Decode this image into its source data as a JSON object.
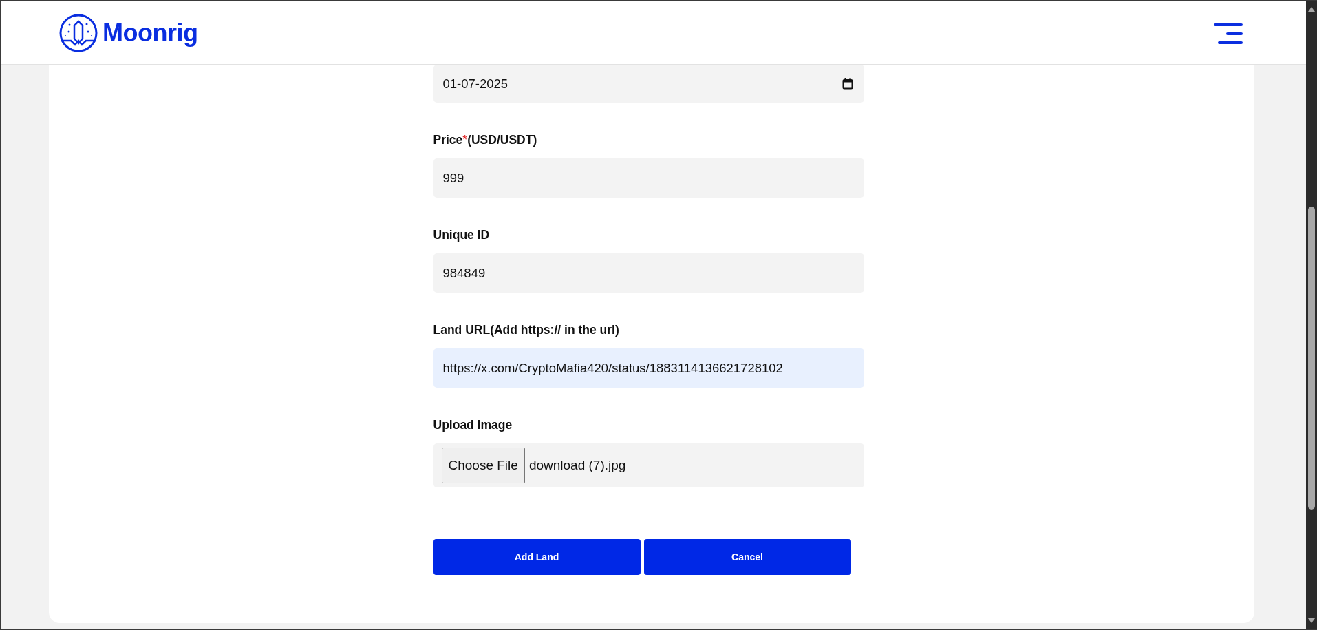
{
  "header": {
    "logo_text": "Moonrig"
  },
  "form": {
    "fields": [
      {
        "kind": "date",
        "value": "01-07-2025"
      },
      {
        "kind": "text",
        "label": "Price",
        "required_mark": "*",
        "label_suffix": "(USD/USDT)",
        "value": "999"
      },
      {
        "kind": "text",
        "label": "Unique ID",
        "value": "984849"
      },
      {
        "kind": "autofilled_text",
        "label": "Land URL(Add https:// in the url)",
        "value": "https://x.com/CryptoMafia420/status/1883114136621728102"
      },
      {
        "kind": "file",
        "label": "Upload Image",
        "button": "Choose File",
        "file_name": "download (7).jpg"
      }
    ],
    "buttons": [
      "Add Land",
      "Cancel"
    ]
  }
}
